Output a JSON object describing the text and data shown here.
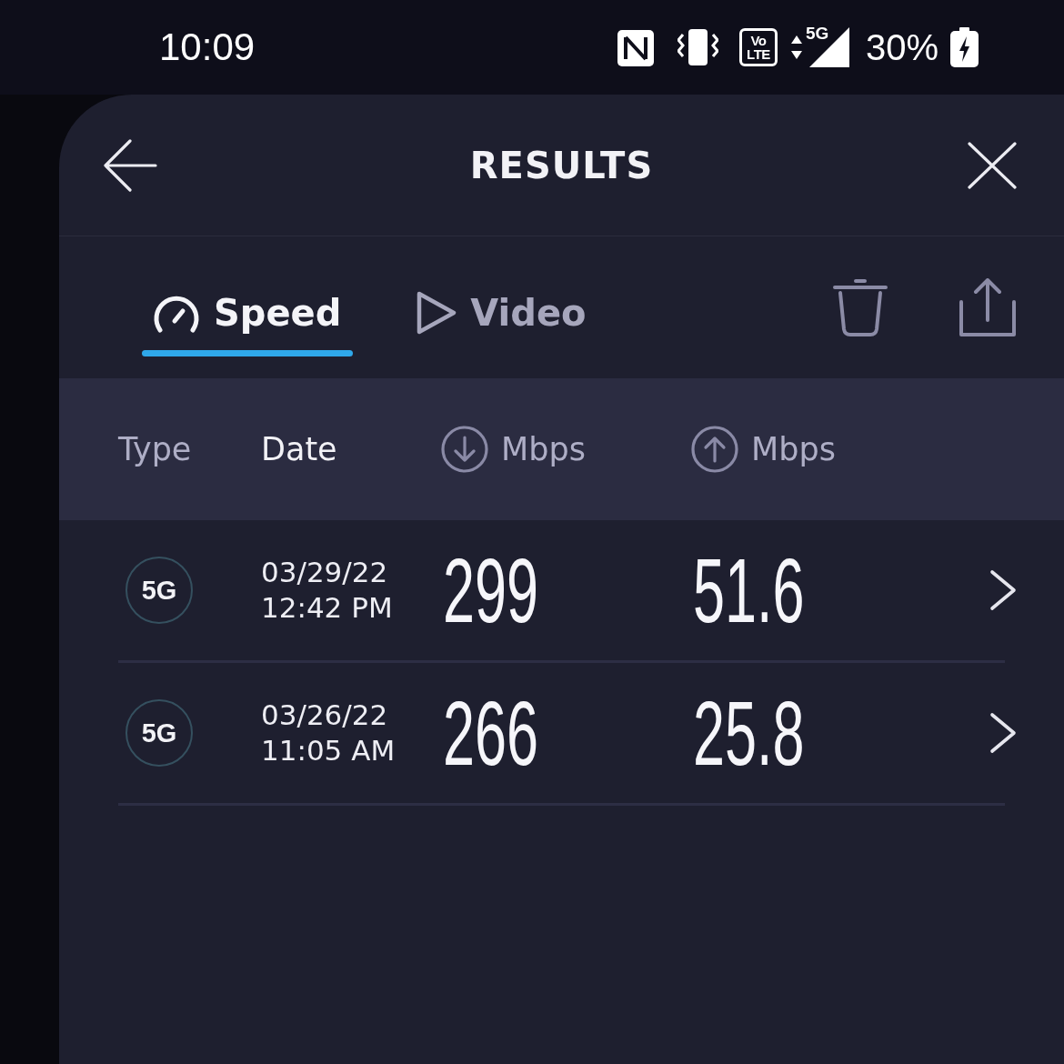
{
  "status_bar": {
    "time": "10:09",
    "volte_top": "Vo",
    "volte_bottom": "LTE",
    "network_type": "5G",
    "battery": "30%"
  },
  "header": {
    "title": "RESULTS"
  },
  "tabs": [
    {
      "label": "Speed",
      "kind": "speed",
      "selected": true
    },
    {
      "label": "Video",
      "kind": "video",
      "selected": false
    }
  ],
  "table": {
    "columns": [
      {
        "label": "Type",
        "kind": "text",
        "selected": false
      },
      {
        "label": "Date",
        "kind": "text",
        "selected": true
      },
      {
        "label": "Mbps",
        "kind": "download",
        "selected": false
      },
      {
        "label": "Mbps",
        "kind": "upload",
        "selected": false
      }
    ],
    "rows": [
      {
        "type": "5G",
        "date": "03/29/22",
        "time": "12:42 PM",
        "download": "299",
        "upload": "51.6"
      },
      {
        "type": "5G",
        "date": "03/26/22",
        "time": "11:05 AM",
        "download": "266",
        "upload": "25.8"
      }
    ]
  }
}
